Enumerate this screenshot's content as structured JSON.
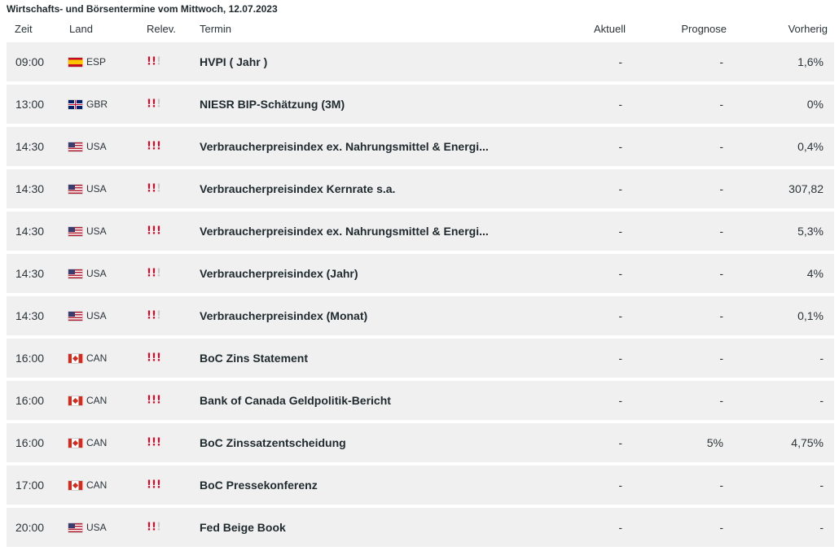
{
  "title": "Wirtschafts- und Börsentermine vom Mittwoch, 12.07.2023",
  "columns": {
    "zeit": "Zeit",
    "land": "Land",
    "relev": "Relev.",
    "termin": "Termin",
    "aktuell": "Aktuell",
    "prognose": "Prognose",
    "vorherig": "Vorherig"
  },
  "colors": {
    "relevance_on": "#c8102e",
    "relevance_off": "#c9c9c9",
    "row_bg": "#f0f0f0"
  },
  "rows": [
    {
      "time": "09:00",
      "flag": "flag-esp",
      "country": "ESP",
      "relevance": 2,
      "termin": "HVPI ( Jahr )",
      "aktuell": "-",
      "prognose": "-",
      "vorherig": "1,6%"
    },
    {
      "time": "13:00",
      "flag": "flag-gbr",
      "country": "GBR",
      "relevance": 2,
      "termin": "NIESR BIP-Schätzung (3M)",
      "aktuell": "-",
      "prognose": "-",
      "vorherig": "0%"
    },
    {
      "time": "14:30",
      "flag": "flag-usa",
      "country": "USA",
      "relevance": 3,
      "termin": "Verbraucherpreisindex ex. Nahrungsmittel & Energi...",
      "aktuell": "-",
      "prognose": "-",
      "vorherig": "0,4%"
    },
    {
      "time": "14:30",
      "flag": "flag-usa",
      "country": "USA",
      "relevance": 2,
      "termin": "Verbraucherpreisindex Kernrate s.a.",
      "aktuell": "-",
      "prognose": "-",
      "vorherig": "307,82"
    },
    {
      "time": "14:30",
      "flag": "flag-usa",
      "country": "USA",
      "relevance": 3,
      "termin": "Verbraucherpreisindex ex. Nahrungsmittel & Energi...",
      "aktuell": "-",
      "prognose": "-",
      "vorherig": "5,3%"
    },
    {
      "time": "14:30",
      "flag": "flag-usa",
      "country": "USA",
      "relevance": 2,
      "termin": "Verbraucherpreisindex (Jahr)",
      "aktuell": "-",
      "prognose": "-",
      "vorherig": "4%"
    },
    {
      "time": "14:30",
      "flag": "flag-usa",
      "country": "USA",
      "relevance": 2,
      "termin": "Verbraucherpreisindex (Monat)",
      "aktuell": "-",
      "prognose": "-",
      "vorherig": "0,1%"
    },
    {
      "time": "16:00",
      "flag": "flag-can",
      "country": "CAN",
      "relevance": 3,
      "termin": "BoC Zins Statement",
      "aktuell": "-",
      "prognose": "-",
      "vorherig": "-"
    },
    {
      "time": "16:00",
      "flag": "flag-can",
      "country": "CAN",
      "relevance": 3,
      "termin": "Bank of Canada Geldpolitik-Bericht",
      "aktuell": "-",
      "prognose": "-",
      "vorherig": "-"
    },
    {
      "time": "16:00",
      "flag": "flag-can",
      "country": "CAN",
      "relevance": 3,
      "termin": "BoC Zinssatzentscheidung",
      "aktuell": "-",
      "prognose": "5%",
      "vorherig": "4,75%"
    },
    {
      "time": "17:00",
      "flag": "flag-can",
      "country": "CAN",
      "relevance": 3,
      "termin": "BoC Pressekonferenz",
      "aktuell": "-",
      "prognose": "-",
      "vorherig": "-"
    },
    {
      "time": "20:00",
      "flag": "flag-usa",
      "country": "USA",
      "relevance": 2,
      "termin": "Fed Beige Book",
      "aktuell": "-",
      "prognose": "-",
      "vorherig": "-"
    }
  ]
}
